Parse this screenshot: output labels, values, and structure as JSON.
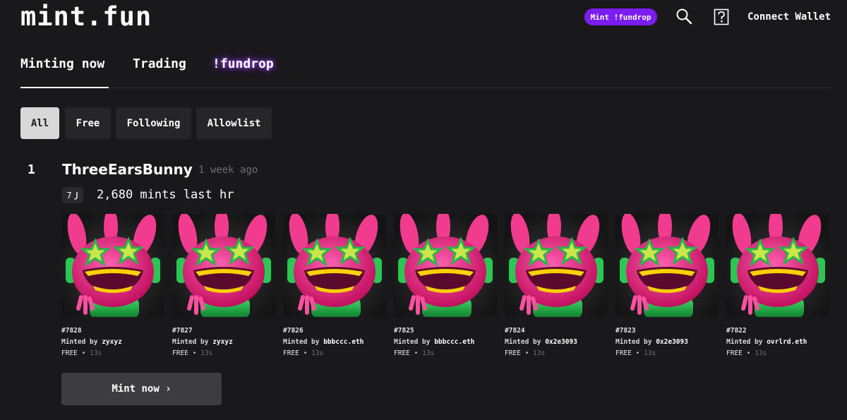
{
  "header": {
    "logo": "mint.fun",
    "fundrop_button": "Mint !fundrop",
    "search_icon": "search-icon",
    "help_icon": "help-icon",
    "connect_wallet": "Connect Wallet",
    "accent": "#7b1cf0"
  },
  "tabs": [
    {
      "label": "Minting now",
      "active": true
    },
    {
      "label": "Trading",
      "active": false
    },
    {
      "label": "!fundrop",
      "active": false
    }
  ],
  "filters": [
    {
      "label": "All",
      "active": true
    },
    {
      "label": "Free",
      "active": false
    },
    {
      "label": "Following",
      "active": false
    },
    {
      "label": "Allowlist",
      "active": false
    }
  ],
  "collection": {
    "rank": "1",
    "name": "ThreeEarsBunny",
    "age": "1 week ago",
    "streak": "7",
    "mints": "2,680 mints last hr",
    "mint_button": "Mint now ›",
    "items": [
      {
        "id": "#7828",
        "minted_prefix": "Minted by ",
        "minter": "zyxyz",
        "price": "FREE",
        "dot": "•",
        "ago": "13s"
      },
      {
        "id": "#7827",
        "minted_prefix": "Minted by ",
        "minter": "zyxyz",
        "price": "FREE",
        "dot": "•",
        "ago": "13s"
      },
      {
        "id": "#7826",
        "minted_prefix": "Minted by ",
        "minter": "bbbccc.eth",
        "price": "FREE",
        "dot": "•",
        "ago": "13s"
      },
      {
        "id": "#7825",
        "minted_prefix": "Minted by ",
        "minter": "bbbccc.eth",
        "price": "FREE",
        "dot": "•",
        "ago": "13s"
      },
      {
        "id": "#7824",
        "minted_prefix": "Minted by ",
        "minter": "0x2e3093",
        "price": "FREE",
        "dot": "•",
        "ago": "13s"
      },
      {
        "id": "#7823",
        "minted_prefix": "Minted by ",
        "minter": "0x2e3093",
        "price": "FREE",
        "dot": "•",
        "ago": "13s"
      },
      {
        "id": "#7822",
        "minted_prefix": "Minted by ",
        "minter": "ovrlrd.eth",
        "price": "FREE",
        "dot": "•",
        "ago": "13s"
      }
    ]
  }
}
